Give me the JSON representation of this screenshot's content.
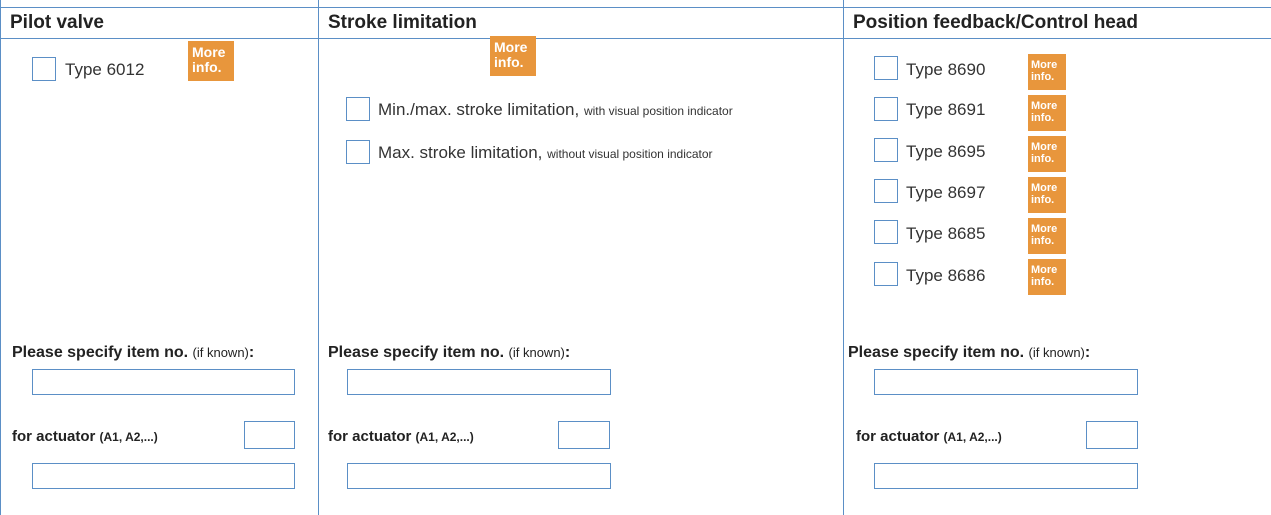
{
  "pilot": {
    "header": "Pilot valve",
    "options": [
      {
        "label": "Type 6012"
      }
    ],
    "more_line1": "More",
    "more_line2": "info.",
    "spec_label": "Please specify item no.",
    "spec_paren": "(if known)",
    "spec_colon": ":",
    "actuator_label": "for actuator",
    "actuator_paren": "(A1, A2,...)"
  },
  "stroke": {
    "header": "Stroke limitation",
    "more_line1": "More",
    "more_line2": "info.",
    "options": [
      {
        "label": "Min./max. stroke limitation,",
        "note": "with visual position indicator"
      },
      {
        "label": "Max. stroke limitation,",
        "note": "without visual position indicator"
      }
    ],
    "spec_label": "Please specify item no.",
    "spec_paren": "(if known)",
    "spec_colon": ":",
    "actuator_label": "for actuator",
    "actuator_paren": "(A1, A2,...)"
  },
  "feedback": {
    "header": "Position feedback/Control head",
    "more_line1": "More",
    "more_line2": "info.",
    "options": [
      {
        "label": "Type 8690"
      },
      {
        "label": "Type 8691"
      },
      {
        "label": "Type 8695"
      },
      {
        "label": "Type 8697"
      },
      {
        "label": "Type 8685"
      },
      {
        "label": "Type 8686"
      }
    ],
    "spec_label": "Please specify item no.",
    "spec_paren": "(if known)",
    "spec_colon": ":",
    "actuator_label": "for actuator",
    "actuator_paren": "(A1, A2,...)"
  },
  "colors": {
    "accent": "#5b8fc6",
    "more_badge": "#e8963c"
  }
}
